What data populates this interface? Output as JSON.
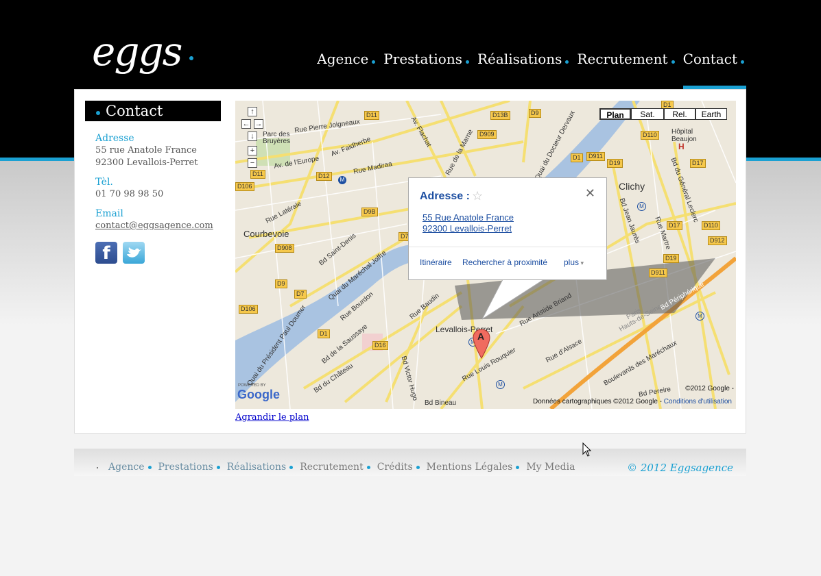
{
  "header": {
    "logo": "eggs",
    "nav": [
      {
        "label": "Agence"
      },
      {
        "label": "Prestations"
      },
      {
        "label": "Réalisations"
      },
      {
        "label": "Recrutement"
      },
      {
        "label": "Contact"
      }
    ],
    "active_nav": "Contact"
  },
  "contact": {
    "title": "Contact",
    "address_label": "Adresse",
    "address_line1": "55 rue Anatole France",
    "address_line2": "92300 Levallois-Perret",
    "phone_label": "Tèl.",
    "phone": "01 70 98 98 50",
    "email_label": "Email",
    "email": "contact@eggsagence.com"
  },
  "map": {
    "types": [
      "Plan",
      "Sat.",
      "Rel.",
      "Earth"
    ],
    "active_type": "Plan",
    "controls": [
      "↑",
      "←",
      "→",
      "↓",
      "+",
      "−"
    ],
    "infowindow": {
      "title": "Adresse :",
      "line1": "55 Rue Anatole France",
      "line2": "92300 Levallois-Perret",
      "link_itinerary": "Itinéraire",
      "link_nearby": "Rechercher à proximité",
      "link_more": "plus"
    },
    "marker_label": "A",
    "labels": {
      "courbevoie": "Courbevoie",
      "clichy": "Clichy",
      "levallois": "Levallois-Perret",
      "parc": "Parc des\nBruyères",
      "hopital": "Hôpital\nBeaujon",
      "rue_pierre": "Rue Pierre Joigneaux",
      "av_faidherbe": "Av. Faidherbe",
      "av_europe": "Av. de l'Europe",
      "rue_madiraa": "Rue Madiraa",
      "rue_laterale": "Rue Latérale",
      "bd_saint_denis": "Bd Saint-Denis",
      "quai_joffre": "Quai du Maréchal Joffre",
      "bd_peripherique": "Bd Périphérique",
      "rue_louis_rouquier": "Rue Louis Rouquier",
      "bd_bineau": "Bd Bineau",
      "bd_victor_hugo": "Bd Victor Hugo",
      "bd_chateau": "Bd du Château",
      "bd_saussaye": "Bd de la Saussaye",
      "quai_doumer": "Quai du Président Paul Doumer",
      "rue_bourdon": "Rue Bourdon",
      "rue_baudin": "Rue Baudin",
      "av_flachat": "Av. Flachat",
      "rue_marne": "Rue de la Marne",
      "quai_dervaux": "Quai du Docteur Dervaux",
      "bd_jaures": "Bd Jean Jaurès",
      "rue_martre": "Rue Martre",
      "bd_leclerc": "Bd du Général Leclerc",
      "bd_mareschaux": "Boulevards des Maréchaux",
      "rue_aristide_briand": "Rue Aristide Briand",
      "rue_alsace": "Rue d'Alsace",
      "bd_pereire": "Bd Pereire",
      "hauts_de_seine": "Hauts-de-Seine",
      "paris": "Paris"
    },
    "road_badges": [
      "D11",
      "D7",
      "D1",
      "D13B",
      "D9",
      "D909",
      "D110",
      "D17",
      "D19",
      "D911",
      "D12",
      "D106",
      "D908",
      "D9B",
      "D9",
      "D7",
      "D106",
      "D1",
      "D16",
      "D17",
      "D110",
      "D912",
      "D19",
      "D911",
      "D1",
      "D11"
    ],
    "powered_by": "POWERED BY",
    "google_logo": "Google",
    "copyright1": "©2012 Google -",
    "copyright2_prefix": "Données cartographiques ©2012 Google -",
    "copyright2_link": "Conditions d'utilisation",
    "enlarge": "Agrandir le plan"
  },
  "footer": {
    "nav": [
      "Agence",
      "Prestations",
      "Réalisations",
      "Recrutement",
      "Crédits",
      "Mentions Légales",
      "My Media"
    ],
    "copyright": "© 2012 Eggsagence"
  },
  "colors": {
    "accent": "#1aa0d2",
    "header_bg": "#000000",
    "map_link": "#1c4ea1"
  }
}
